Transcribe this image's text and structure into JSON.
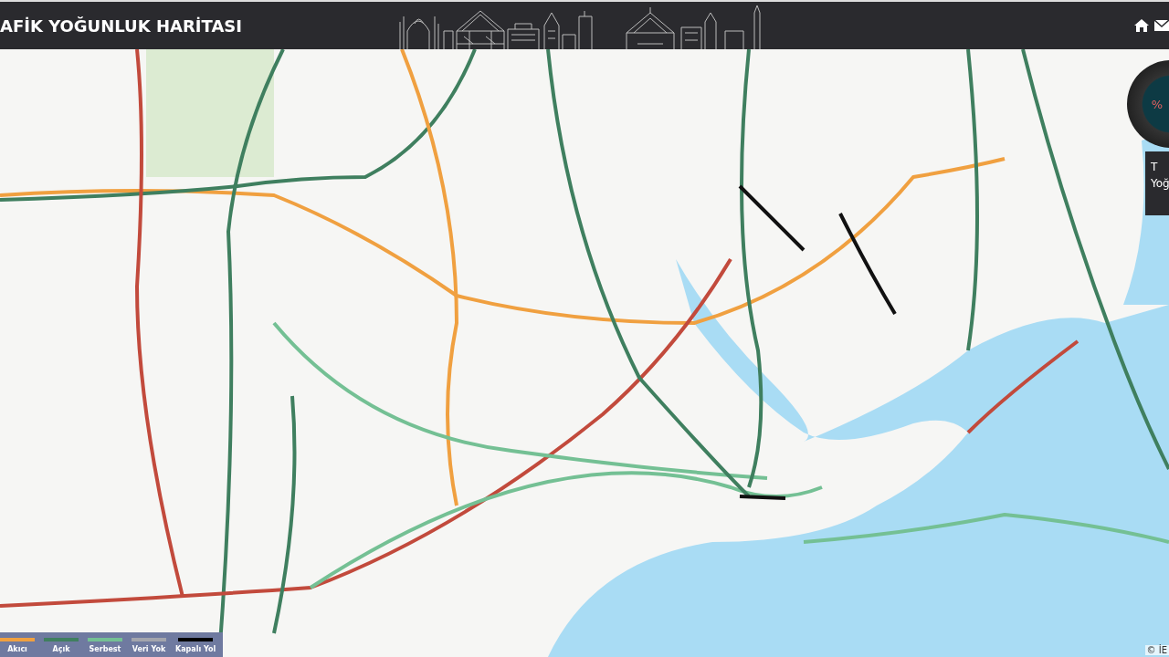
{
  "header": {
    "title": "AFİK YOĞUNLUK HARİTASI"
  },
  "legend": [
    {
      "label": "Akıcı",
      "color": "#f0a040"
    },
    {
      "label": "Açık",
      "color": "#3f7f5f"
    },
    {
      "label": "Serbest",
      "color": "#74c094"
    },
    {
      "label": "Veri Yok",
      "color": "#a3a5ad"
    },
    {
      "label": "Kapalı Yol",
      "color": "#000000"
    }
  ],
  "gauge": {
    "symbol": "%",
    "panel_lines": [
      "T",
      "Yoğ"
    ]
  },
  "attribution": "© İE"
}
